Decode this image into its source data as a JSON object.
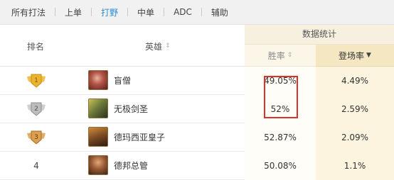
{
  "tabs": [
    {
      "label": "所有打法",
      "active": false
    },
    {
      "label": "上单",
      "active": false
    },
    {
      "label": "打野",
      "active": true
    },
    {
      "label": "中单",
      "active": false
    },
    {
      "label": "ADC",
      "active": false
    },
    {
      "label": "辅助",
      "active": false
    }
  ],
  "header": {
    "rank": "排名",
    "hero": "英雄",
    "stats_group": "数据统计",
    "win_rate": "胜率",
    "pick_rate": "登场率",
    "sort_icon": "⇕",
    "sort_desc_icon": "▼"
  },
  "rows": [
    {
      "rank": "1",
      "rank_style": "gold",
      "hero": "盲僧",
      "win_rate": "49.05%",
      "pick_rate": "4.49%"
    },
    {
      "rank": "2",
      "rank_style": "silver",
      "hero": "无极剑圣",
      "win_rate": "52%",
      "pick_rate": "2.59%"
    },
    {
      "rank": "3",
      "rank_style": "bronze",
      "hero": "德玛西亚皇子",
      "win_rate": "52.87%",
      "pick_rate": "2.09%"
    },
    {
      "rank": "4",
      "rank_style": "plain",
      "hero": "德邦总管",
      "win_rate": "50.08%",
      "pick_rate": "1.1%"
    }
  ],
  "colors": {
    "accent": "#2d8ad8",
    "highlight_box": "#d9342b",
    "gold": "#e9b531",
    "silver": "#b9b9b9",
    "bronze": "#d9a054"
  }
}
